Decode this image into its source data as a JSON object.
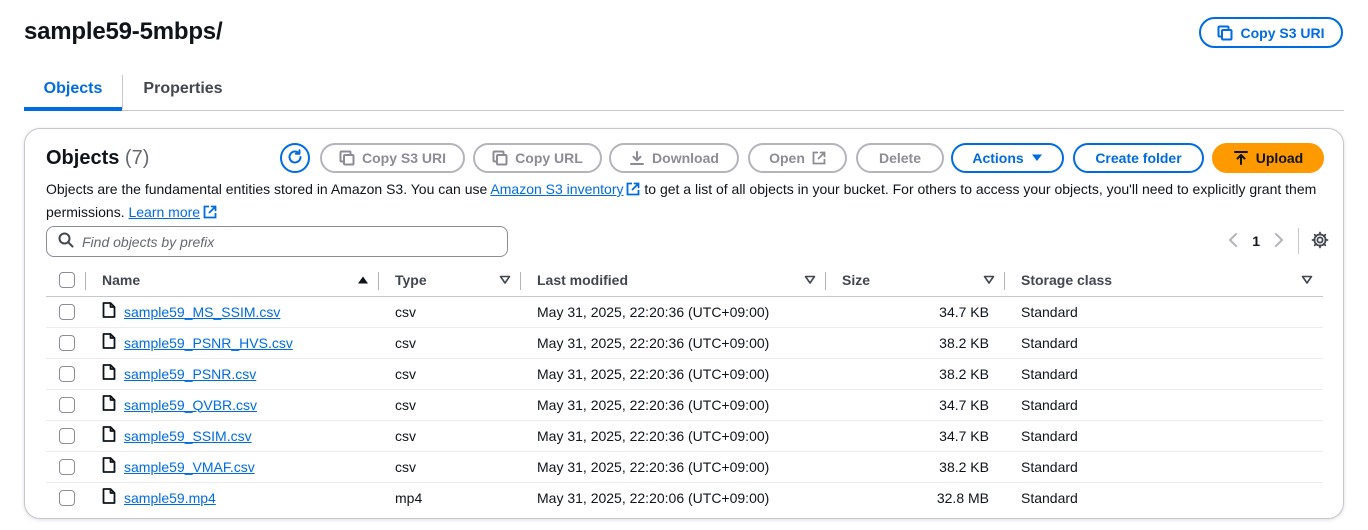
{
  "page": {
    "title": "sample59-5mbps/",
    "copy_s3_uri_label": "Copy S3 URI"
  },
  "tabs": [
    {
      "label": "Objects"
    },
    {
      "label": "Properties"
    }
  ],
  "objects_panel": {
    "title": "Objects",
    "count": "(7)",
    "buttons": {
      "copy_s3_uri": "Copy S3 URI",
      "copy_url": "Copy URL",
      "download": "Download",
      "open": "Open",
      "delete": "Delete",
      "actions": "Actions",
      "create_folder": "Create folder",
      "upload": "Upload"
    },
    "description": {
      "part1": "Objects are the fundamental entities stored in Amazon S3. You can use",
      "inventory_link": "Amazon S3 inventory",
      "part2": "to get a list of all objects in your bucket. For others to access your objects, you'll need to explicitly grant them permissions.",
      "learn_more": "Learn more"
    },
    "search": {
      "placeholder": "Find objects by prefix"
    },
    "pagination": {
      "current_page": "1"
    },
    "columns": [
      "Name",
      "Type",
      "Last modified",
      "Size",
      "Storage class"
    ],
    "rows": [
      {
        "name": "sample59_MS_SSIM.csv",
        "type": "csv",
        "modified": "May 31, 2025, 22:20:36 (UTC+09:00)",
        "size": "34.7 KB",
        "storage": "Standard"
      },
      {
        "name": "sample59_PSNR_HVS.csv",
        "type": "csv",
        "modified": "May 31, 2025, 22:20:36 (UTC+09:00)",
        "size": "38.2 KB",
        "storage": "Standard"
      },
      {
        "name": "sample59_PSNR.csv",
        "type": "csv",
        "modified": "May 31, 2025, 22:20:36 (UTC+09:00)",
        "size": "38.2 KB",
        "storage": "Standard"
      },
      {
        "name": "sample59_QVBR.csv",
        "type": "csv",
        "modified": "May 31, 2025, 22:20:36 (UTC+09:00)",
        "size": "34.7 KB",
        "storage": "Standard"
      },
      {
        "name": "sample59_SSIM.csv",
        "type": "csv",
        "modified": "May 31, 2025, 22:20:36 (UTC+09:00)",
        "size": "34.7 KB",
        "storage": "Standard"
      },
      {
        "name": "sample59_VMAF.csv",
        "type": "csv",
        "modified": "May 31, 2025, 22:20:36 (UTC+09:00)",
        "size": "38.2 KB",
        "storage": "Standard"
      },
      {
        "name": "sample59.mp4",
        "type": "mp4",
        "modified": "May 31, 2025, 22:20:06 (UTC+09:00)",
        "size": "32.8 MB",
        "storage": "Standard"
      }
    ]
  },
  "colors": {
    "accent": "#006ce0",
    "primary_button": "#ff9900",
    "disabled": "#8c8c94",
    "text": "#0f141a"
  }
}
